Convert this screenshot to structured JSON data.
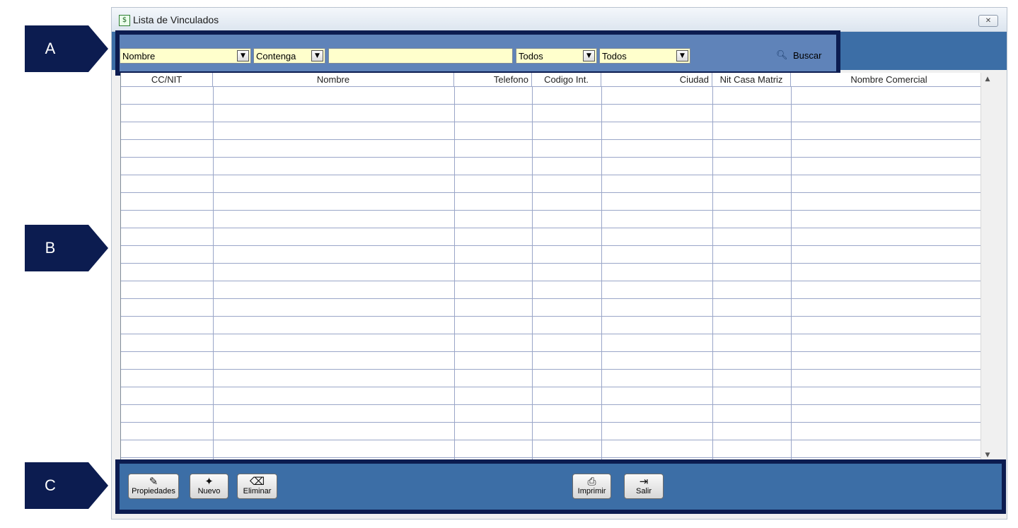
{
  "callouts": [
    "A",
    "B",
    "C"
  ],
  "window": {
    "title": "Lista de Vinculados",
    "close_label": "✕"
  },
  "filters": {
    "field": "Nombre",
    "operator": "Contenga",
    "search_value": "",
    "filter1": "Todos",
    "filter2": "Todos",
    "search_button": "Buscar"
  },
  "grid": {
    "columns": [
      "CC/NIT",
      "Nombre",
      "Telefono",
      "Codigo Int.",
      "Ciudad",
      "Nit Casa Matriz",
      "Nombre Comercial"
    ]
  },
  "actions": {
    "propiedades": "Propiedades",
    "nuevo": "Nuevo",
    "eliminar": "Eliminar",
    "imprimir": "Imprimir",
    "salir": "Salir"
  }
}
